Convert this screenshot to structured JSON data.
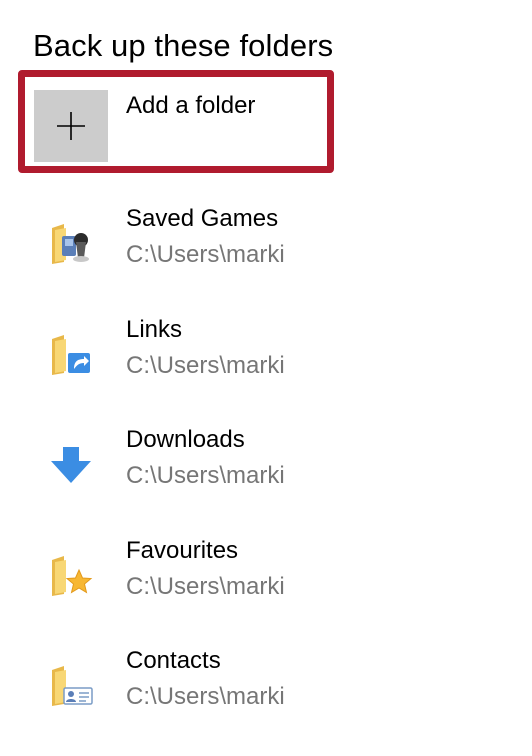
{
  "section": {
    "title": "Back up these folders"
  },
  "add_folder": {
    "label": "Add a folder",
    "icon": "plus-icon"
  },
  "folders": [
    {
      "name": "Saved Games",
      "path": "C:\\Users\\marki",
      "icon": "saved-games-folder-icon"
    },
    {
      "name": "Links",
      "path": "C:\\Users\\marki",
      "icon": "links-folder-icon"
    },
    {
      "name": "Downloads",
      "path": "C:\\Users\\marki",
      "icon": "downloads-arrow-icon"
    },
    {
      "name": "Favourites",
      "path": "C:\\Users\\marki",
      "icon": "favourites-folder-icon"
    },
    {
      "name": "Contacts",
      "path": "C:\\Users\\marki",
      "icon": "contacts-folder-icon"
    }
  ],
  "colors": {
    "highlight_border": "#b01b2e",
    "add_tile": "#cccccc",
    "path_text": "#767676",
    "folder_yellow": "#f8d775",
    "download_blue": "#3b8de3"
  }
}
